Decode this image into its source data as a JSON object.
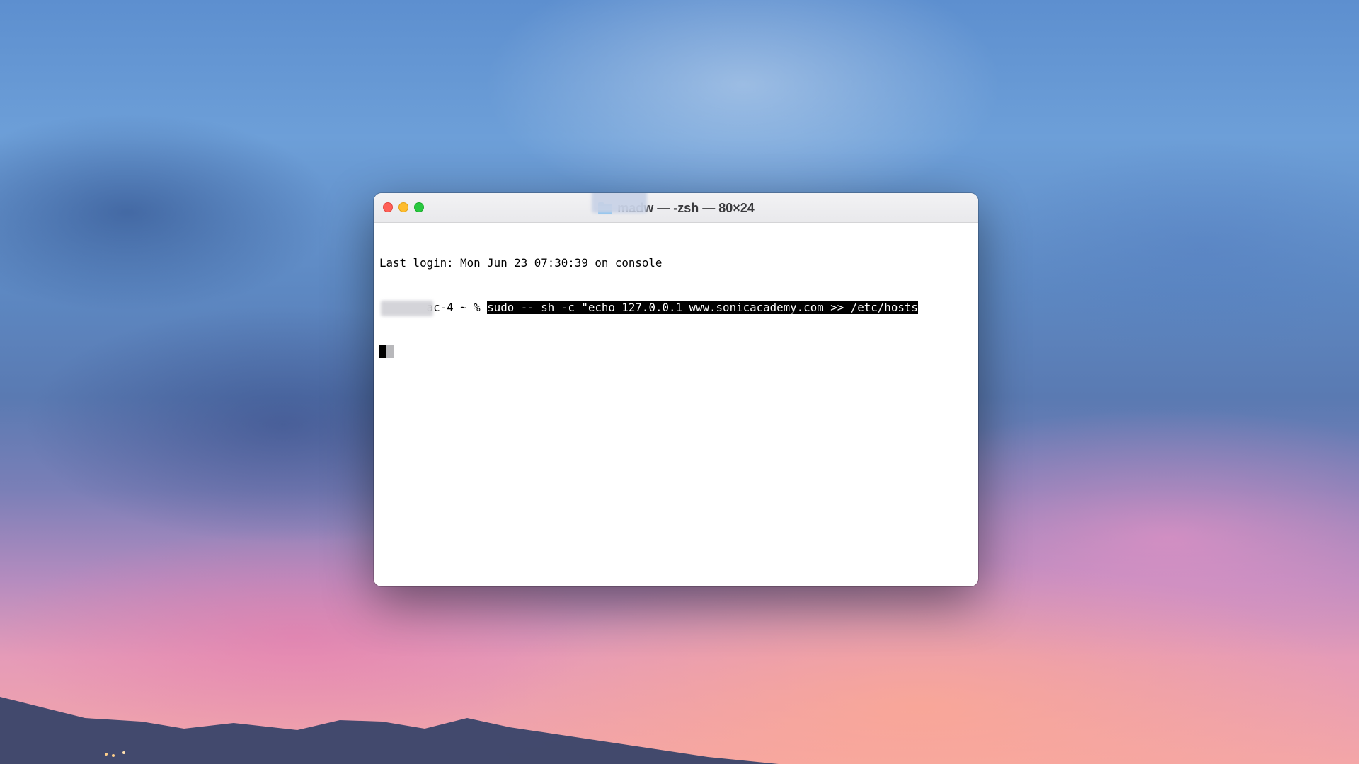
{
  "window": {
    "title": "madw — -zsh — 80×24"
  },
  "terminal": {
    "lines": [
      "Last login: Mon Jun 23 07:30:39 on console"
    ],
    "prompt": "ac-4 ~ % ",
    "command": "sudo -- sh -c \"echo 127.0.0.1 www.sonicacademy.com >> /etc/hosts"
  },
  "colors": {
    "close": "#ff5f57",
    "minimize": "#febc2e",
    "zoom": "#28c840",
    "selection_bg": "#000000",
    "selection_fg": "#ffffff"
  },
  "icons": {
    "title": "folder-icon"
  }
}
